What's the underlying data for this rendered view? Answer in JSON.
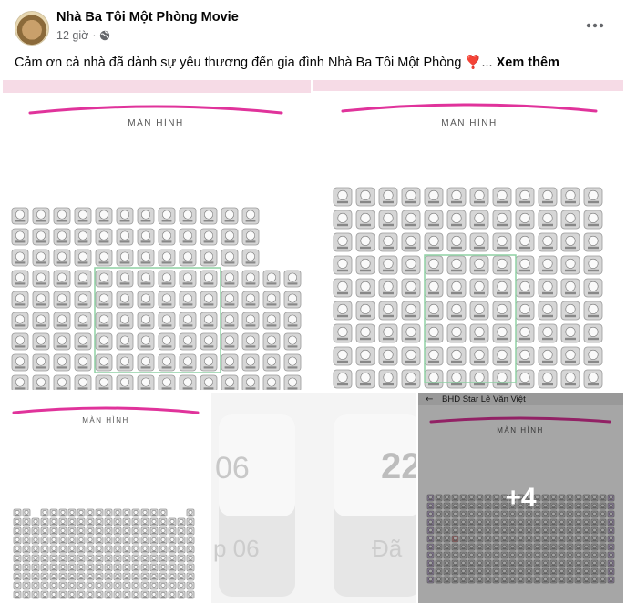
{
  "post": {
    "page_name": "Nhà Ba Tôi Một Phòng Movie",
    "time": "12 giờ",
    "dot": "·",
    "caption_text": "Cảm ơn cả nhà đã dành sự yêu thương đến gia đình Nhà Ba Tôi Một Phòng ",
    "caption_emoji": "❣️",
    "caption_ellipsis": "...",
    "see_more": "Xem thêm"
  },
  "photos": [
    {
      "screen_label": "MÀN HÌNH"
    },
    {
      "screen_label": "MÀN HÌNH"
    },
    {
      "screen_label": "MÀN HÌNH"
    },
    {
      "big_numbers": [
        "06",
        "22"
      ],
      "captions": [
        "p 06",
        "Đã"
      ]
    },
    {
      "header_title": "BHD Star Lê Văn Việt",
      "screen_label": "MÀN HÌNH",
      "more_count": "+4"
    }
  ],
  "icons": {
    "globe": "globe-icon",
    "more": "ellipsis-icon",
    "back": "arrow-left-icon"
  },
  "colors": {
    "screen_arc": "#e0339b",
    "seat_fill": "#d8d8d8",
    "selection_box": "#8fd0a4",
    "text_primary": "#050505",
    "text_secondary": "#65676b"
  }
}
